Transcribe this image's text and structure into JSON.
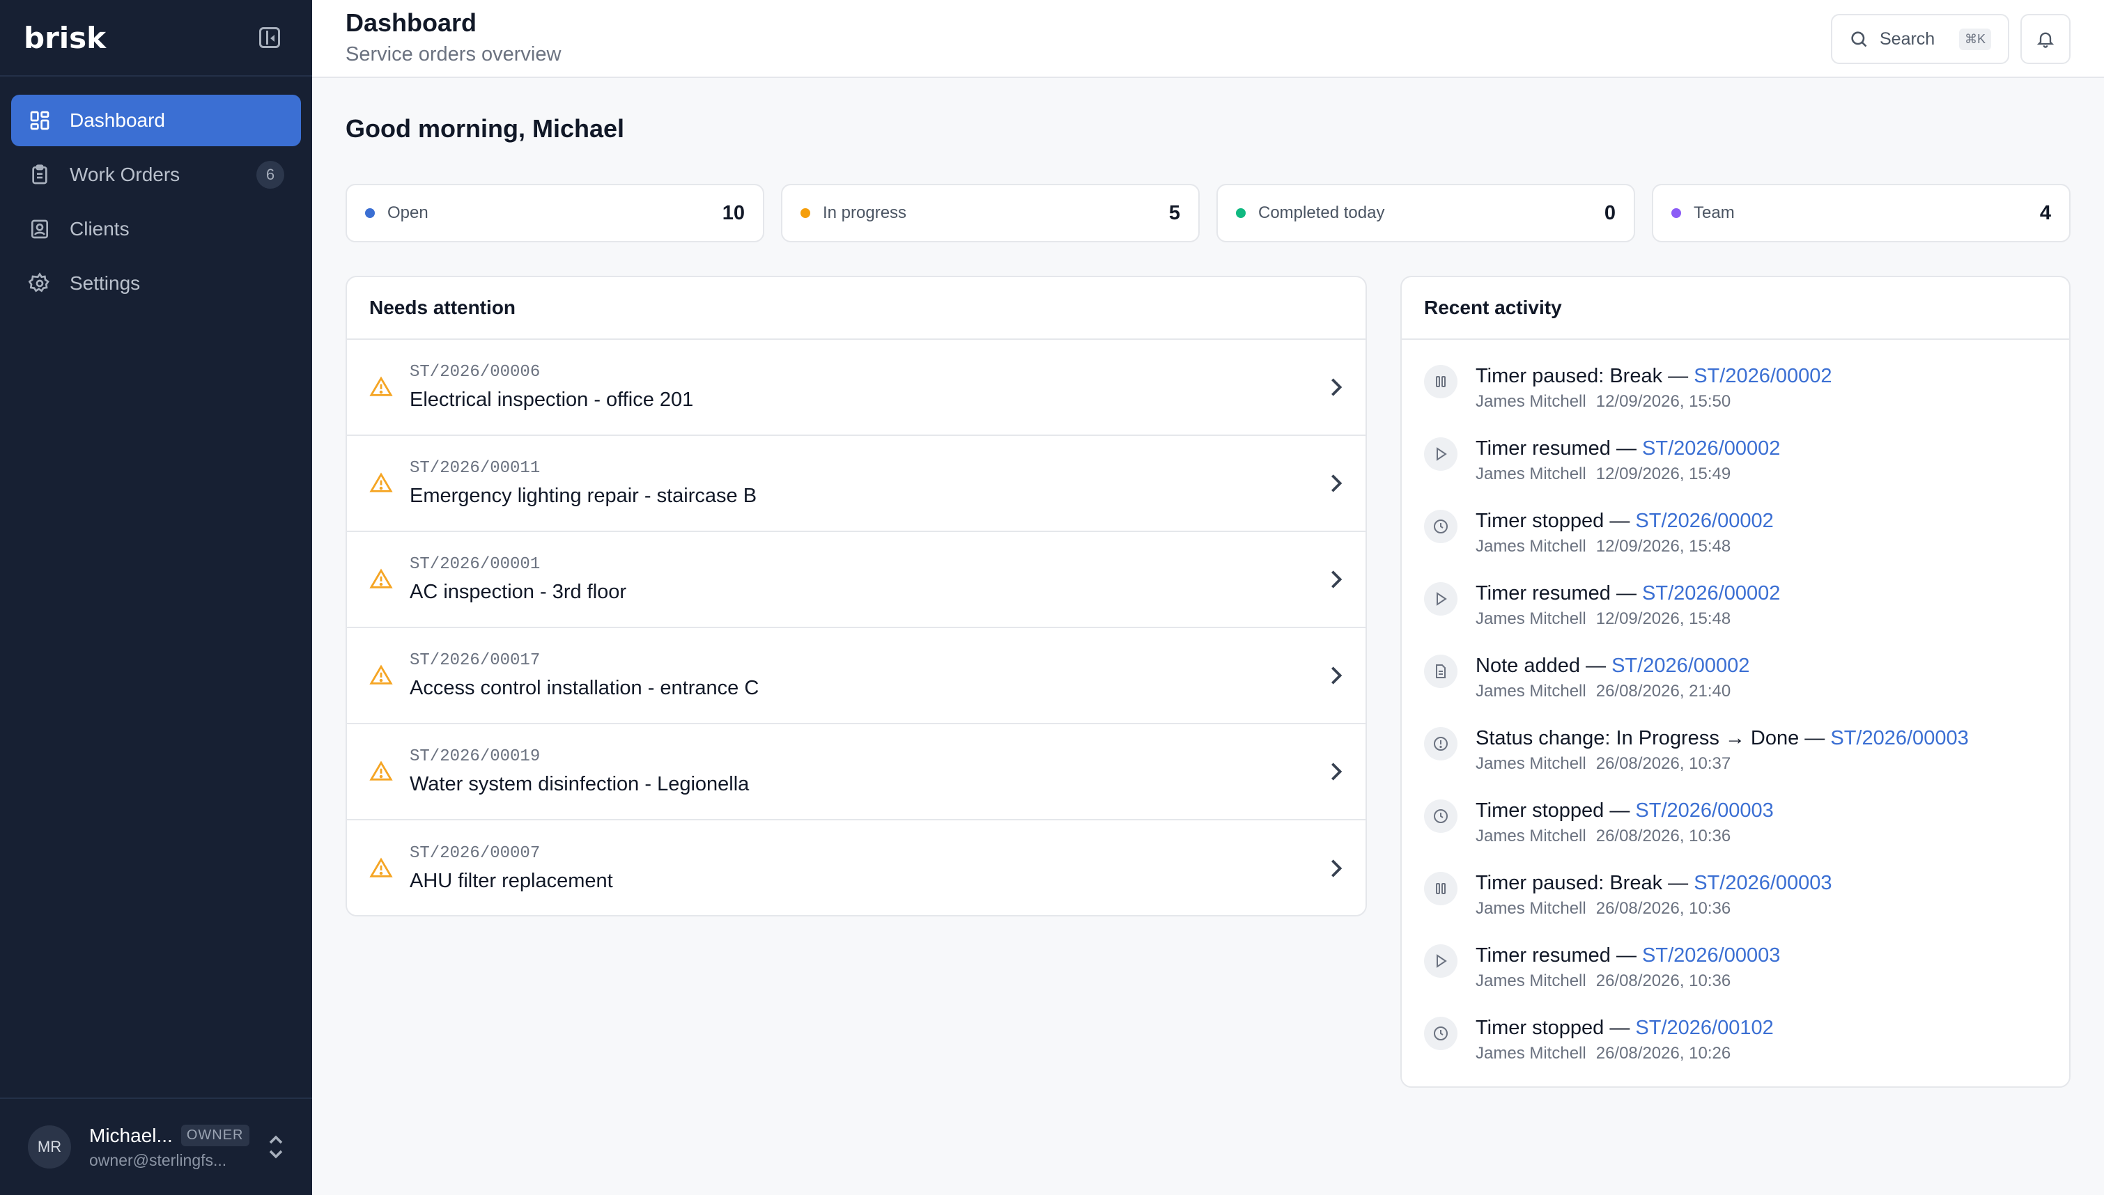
{
  "app": {
    "logo": "brisk"
  },
  "sidebar": {
    "items": [
      {
        "label": "Dashboard",
        "icon": "dashboard-icon",
        "active": true
      },
      {
        "label": "Work Orders",
        "icon": "clipboard-icon",
        "badge": "6"
      },
      {
        "label": "Clients",
        "icon": "contact-icon"
      },
      {
        "label": "Settings",
        "icon": "gear-icon"
      }
    ],
    "user": {
      "initials": "MR",
      "name": "Michael...",
      "role": "OWNER",
      "email": "owner@sterlingfs..."
    }
  },
  "header": {
    "title": "Dashboard",
    "subtitle": "Service orders overview",
    "search_label": "Search",
    "search_shortcut": "⌘K"
  },
  "main": {
    "greeting": "Good morning, Michael",
    "stats": [
      {
        "label": "Open",
        "value": "10",
        "color": "#3b6fd3"
      },
      {
        "label": "In progress",
        "value": "5",
        "color": "#f59e0b"
      },
      {
        "label": "Completed today",
        "value": "0",
        "color": "#10b981"
      },
      {
        "label": "Team",
        "value": "4",
        "color": "#8b5cf6"
      }
    ],
    "attention": {
      "title": "Needs attention",
      "items": [
        {
          "code": "ST/2026/00006",
          "title": "Electrical inspection - office 201"
        },
        {
          "code": "ST/2026/00011",
          "title": "Emergency lighting repair - staircase B"
        },
        {
          "code": "ST/2026/00001",
          "title": "AC inspection - 3rd floor"
        },
        {
          "code": "ST/2026/00017",
          "title": "Access control installation - entrance C"
        },
        {
          "code": "ST/2026/00019",
          "title": "Water system disinfection - Legionella"
        },
        {
          "code": "ST/2026/00007",
          "title": "AHU filter replacement"
        }
      ]
    },
    "activity": {
      "title": "Recent activity",
      "items": [
        {
          "icon": "pause-icon",
          "text": "Timer paused: Break — ",
          "link": "ST/2026/00002",
          "user": "James Mitchell",
          "time": "12/09/2026, 15:50"
        },
        {
          "icon": "play-icon",
          "text": "Timer resumed — ",
          "link": "ST/2026/00002",
          "user": "James Mitchell",
          "time": "12/09/2026, 15:49"
        },
        {
          "icon": "clock-icon",
          "text": "Timer stopped — ",
          "link": "ST/2026/00002",
          "user": "James Mitchell",
          "time": "12/09/2026, 15:48"
        },
        {
          "icon": "play-icon",
          "text": "Timer resumed — ",
          "link": "ST/2026/00002",
          "user": "James Mitchell",
          "time": "12/09/2026, 15:48"
        },
        {
          "icon": "note-icon",
          "text": "Note added — ",
          "link": "ST/2026/00002",
          "user": "James Mitchell",
          "time": "26/08/2026, 21:40"
        },
        {
          "icon": "info-icon",
          "text": "Status change: In Progress → Done — ",
          "link": "ST/2026/00003",
          "user": "James Mitchell",
          "time": "26/08/2026, 10:37"
        },
        {
          "icon": "clock-icon",
          "text": "Timer stopped — ",
          "link": "ST/2026/00003",
          "user": "James Mitchell",
          "time": "26/08/2026, 10:36"
        },
        {
          "icon": "pause-icon",
          "text": "Timer paused: Break — ",
          "link": "ST/2026/00003",
          "user": "James Mitchell",
          "time": "26/08/2026, 10:36"
        },
        {
          "icon": "play-icon",
          "text": "Timer resumed — ",
          "link": "ST/2026/00003",
          "user": "James Mitchell",
          "time": "26/08/2026, 10:36"
        },
        {
          "icon": "clock-icon",
          "text": "Timer stopped — ",
          "link": "ST/2026/00102",
          "user": "James Mitchell",
          "time": "26/08/2026, 10:26"
        }
      ]
    }
  }
}
